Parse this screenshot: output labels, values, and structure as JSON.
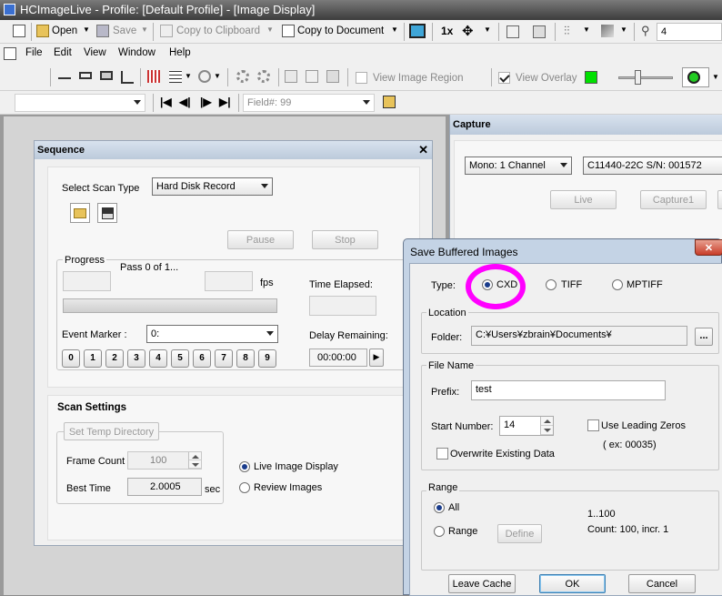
{
  "window": {
    "title": "HCImageLive - Profile: [Default Profile] - [Image Display]"
  },
  "toolbar1": {
    "open": "Open",
    "save": "Save",
    "copy_clipboard": "Copy to Clipboard",
    "copy_document": "Copy to Document",
    "zoom": "1x",
    "magnifier_value": "4"
  },
  "menubar": {
    "items": [
      "File",
      "Edit",
      "View",
      "Window",
      "Help"
    ]
  },
  "toolbar2": {
    "view_image_region": "View Image Region",
    "view_overlay": "View Overlay",
    "overlay_color": "#00e000"
  },
  "toolbar3": {
    "field": "Field#: 99"
  },
  "sequence": {
    "title": "Sequence",
    "select_scan_type_label": "Select Scan Type",
    "scan_type": "Hard Disk Record",
    "pause": "Pause",
    "stop": "Stop",
    "progress_label": "Progress",
    "pass_text": "Pass 0 of 1...",
    "fps": "fps",
    "time_elapsed": "Time Elapsed:",
    "event_marker_label": "Event Marker :",
    "event_marker_value": "0:",
    "delay_remaining": "Delay Remaining:",
    "delay_value": "00:00:00",
    "numbers": [
      "0",
      "1",
      "2",
      "3",
      "4",
      "5",
      "6",
      "7",
      "8",
      "9"
    ],
    "scan_settings": "Scan Settings",
    "set_temp_dir": "Set Temp Directory",
    "frame_count_label": "Frame Count",
    "frame_count": "100",
    "best_time_label": "Best Time",
    "best_time": "2.0005",
    "sec": "sec",
    "live_image_display": "Live Image Display",
    "review_images": "Review Images"
  },
  "capture": {
    "title": "Capture",
    "channel": "Mono: 1 Channel",
    "camera": "C11440-22C S/N: 001572",
    "live": "Live",
    "capture1": "Capture1"
  },
  "dialog": {
    "title": "Save Buffered Images",
    "close": "✕",
    "type_label": "Type:",
    "types": [
      "CXD",
      "TIFF",
      "MPTIFF"
    ],
    "location_label": "Location",
    "folder_label": "Folder:",
    "folder": "C:¥Users¥zbrain¥Documents¥",
    "browse": "...",
    "file_name_label": "File Name",
    "prefix_label": "Prefix:",
    "prefix": "test",
    "start_number_label": "Start Number:",
    "start_number": "14",
    "leading_zeros": "Use Leading Zeros",
    "example": "( ex: 00035)",
    "overwrite": "Overwrite Existing Data",
    "range_label": "Range",
    "all": "All",
    "range": "Range",
    "define": "Define",
    "range_value": "1..100",
    "range_count": "Count: 100, incr. 1",
    "leave_cache": "Leave Cache",
    "ok": "OK",
    "cancel": "Cancel",
    "highlight_color": "#ff00ff"
  }
}
